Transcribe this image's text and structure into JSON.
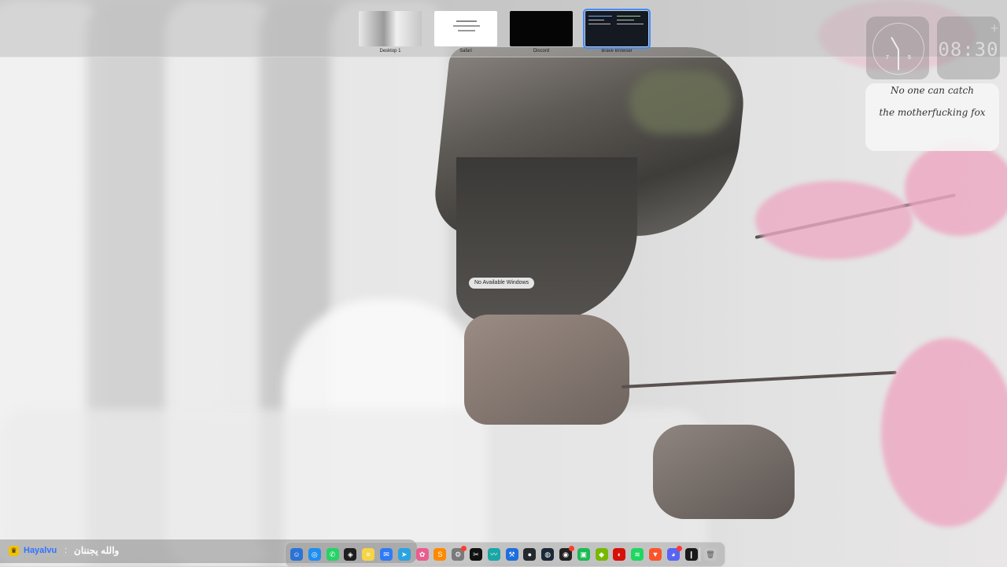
{
  "spaces": [
    {
      "label": "Desktop 1",
      "active": false
    },
    {
      "label": "Safari",
      "active": false
    },
    {
      "label": "Discord",
      "active": false
    },
    {
      "label": "Brave Browser",
      "active": true
    }
  ],
  "widgets": {
    "analog_clock": {
      "numbers": [
        "7",
        "5"
      ]
    },
    "digital_clock": {
      "time": "08:30"
    },
    "note": {
      "line1": "No one can catch",
      "line2": "the motherfucking fox"
    }
  },
  "center_pill": "No Available Windows",
  "status": {
    "user": "Hayalvu",
    "separator": ":",
    "message": "والله يجننان"
  },
  "dock": {
    "apps": [
      {
        "name": "finder",
        "color": "#2b73d6",
        "glyph": "☺"
      },
      {
        "name": "safari",
        "color": "#1f8ef1",
        "glyph": "◎"
      },
      {
        "name": "whatsapp",
        "color": "#25d366",
        "glyph": "✆"
      },
      {
        "name": "figma",
        "color": "#1e1e1e",
        "glyph": "◈"
      },
      {
        "name": "notes",
        "color": "#f5d547",
        "glyph": "≡"
      },
      {
        "name": "mail",
        "color": "#2f7bf6",
        "glyph": "✉"
      },
      {
        "name": "telegram",
        "color": "#2aa3e0",
        "glyph": "➤"
      },
      {
        "name": "photos",
        "color": "#e95d8f",
        "glyph": "✿"
      },
      {
        "name": "sublime",
        "color": "#ff8a00",
        "glyph": "S"
      },
      {
        "name": "system-settings",
        "color": "#7a7a7a",
        "glyph": "⚙",
        "badge": true
      },
      {
        "name": "capcut",
        "color": "#111111",
        "glyph": "✂"
      },
      {
        "name": "freeform",
        "color": "#1aa6a6",
        "glyph": "〰"
      },
      {
        "name": "xcode",
        "color": "#1c6fdd",
        "glyph": "⚒"
      },
      {
        "name": "github",
        "color": "#24292e",
        "glyph": "●"
      },
      {
        "name": "steam",
        "color": "#1b2838",
        "glyph": "◍"
      },
      {
        "name": "activity-monitor",
        "color": "#222222",
        "glyph": "◉",
        "badge": true
      },
      {
        "name": "terminal-app",
        "color": "#1db954",
        "glyph": "▣"
      },
      {
        "name": "nvidia",
        "color": "#76b900",
        "glyph": "◆"
      },
      {
        "name": "lastfm",
        "color": "#d51007",
        "glyph": "◐"
      },
      {
        "name": "spotify",
        "color": "#1ed760",
        "glyph": "≋"
      },
      {
        "name": "brave",
        "color": "#fb542b",
        "glyph": "▼"
      },
      {
        "name": "discord",
        "color": "#5865f2",
        "glyph": "◕",
        "badge": true
      },
      {
        "name": "audio-monitor",
        "color": "#1a1a1a",
        "glyph": "❙"
      }
    ],
    "trash": {
      "name": "trash",
      "glyph": "🗑"
    }
  }
}
